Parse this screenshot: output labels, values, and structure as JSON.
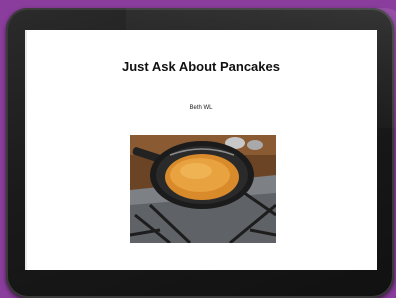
{
  "document": {
    "title": "Just Ask About Pancakes",
    "author": "Beth WL"
  },
  "photo": {
    "subject": "pancake-in-frying-pan-on-gas-stove"
  },
  "colors": {
    "background": "#8a3d9c",
    "bezel": "#1a1a1a",
    "screen": "#ffffff"
  }
}
